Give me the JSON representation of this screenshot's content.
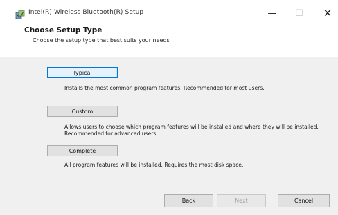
{
  "window": {
    "title": "Intel(R) Wireless Bluetooth(R) Setup",
    "minimize_glyph": "—",
    "maximize_glyph": "☐",
    "close_glyph": "✕",
    "app_icon": "installer-icon"
  },
  "header": {
    "title": "Choose Setup Type",
    "subtitle": "Choose the setup type that best suits your needs"
  },
  "options": [
    {
      "label": "Typical",
      "description": "Installs the most common program features. Recommended for most users.",
      "focused": true
    },
    {
      "label": "Custom",
      "description": "Allows users to choose which program features will be installed and where they will be installed. Recommended for advanced users.",
      "focused": false
    },
    {
      "label": "Complete",
      "description": "All program features will be installed. Requires the most disk space.",
      "focused": false
    }
  ],
  "footer": {
    "back_label": "Back",
    "next_label": "Next",
    "cancel_label": "Cancel",
    "next_enabled": false
  },
  "colors": {
    "focus_border": "#0078d7",
    "panel_background": "#f0f0f0",
    "button_background": "#e1e1e1"
  }
}
